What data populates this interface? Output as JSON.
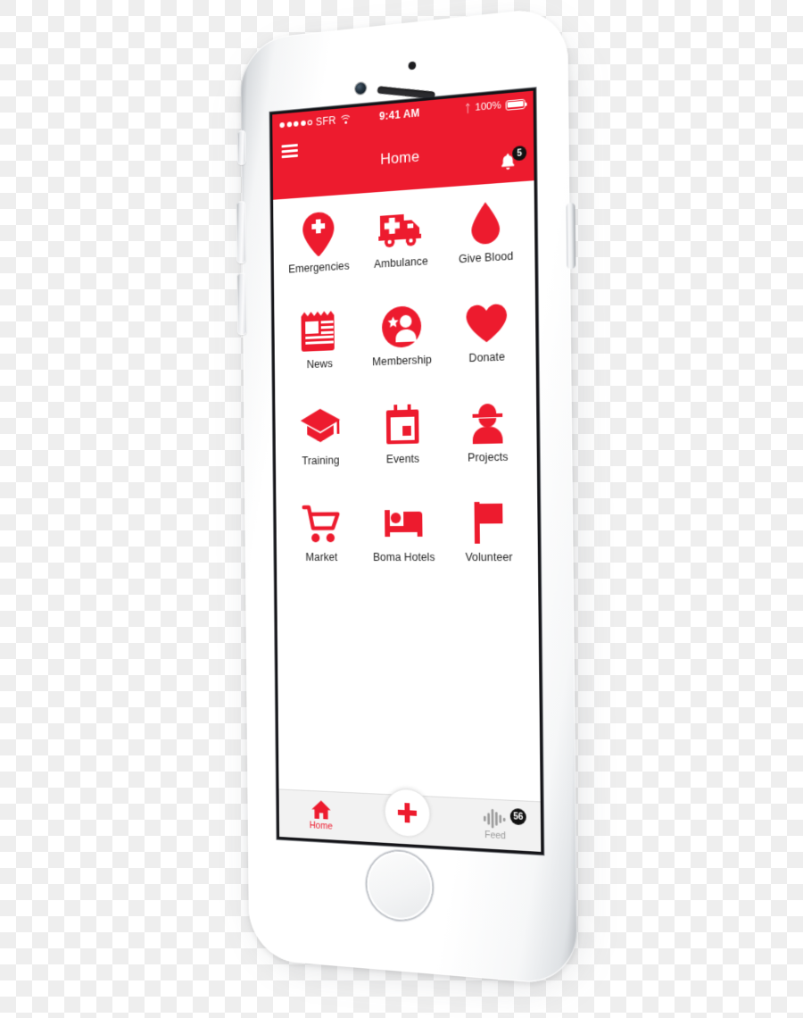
{
  "theme": {
    "brand_red": "#ED1B2E",
    "badge_black": "#111111",
    "tabbar_grey": "#F2F2F2",
    "inactive_grey": "#9A9A9A"
  },
  "device": {
    "name": "white-iphone-6",
    "hardware": {
      "mute_switch": "mute-switch",
      "volume_up": "volume-up-button",
      "volume_down": "volume-down-button",
      "power": "power-button",
      "home_button": "home-button",
      "front_camera": "front-camera",
      "earpiece": "earpiece-speaker",
      "proximity_sensor": "proximity-sensor"
    }
  },
  "status_bar": {
    "signal_dots_filled": 4,
    "signal_dots_total": 5,
    "carrier": "SFR",
    "wifi": "wifi-icon",
    "time": "9:41 AM",
    "bluetooth": "bluetooth-icon",
    "battery_percent": "100%",
    "battery_level": 100
  },
  "nav_bar": {
    "menu_icon": "hamburger-menu-icon",
    "title": "Home",
    "notifications": {
      "icon": "bell-icon",
      "badge_count": "5"
    }
  },
  "grid": {
    "tiles": [
      {
        "label": "Emergencies",
        "icon": "map-pin-cross-icon"
      },
      {
        "label": "Ambulance",
        "icon": "ambulance-icon"
      },
      {
        "label": "Give Blood",
        "icon": "blood-drop-icon"
      },
      {
        "label": "News",
        "icon": "newspaper-icon"
      },
      {
        "label": "Membership",
        "icon": "person-star-icon"
      },
      {
        "label": "Donate",
        "icon": "heart-icon"
      },
      {
        "label": "Training",
        "icon": "graduation-cap-icon"
      },
      {
        "label": "Events",
        "icon": "calendar-icon"
      },
      {
        "label": "Projects",
        "icon": "hard-hat-worker-icon"
      },
      {
        "label": "Market",
        "icon": "shopping-cart-icon"
      },
      {
        "label": "Boma Hotels",
        "icon": "bed-icon"
      },
      {
        "label": "Volunteer",
        "icon": "flag-icon"
      }
    ]
  },
  "tab_bar": {
    "home": {
      "label": "Home",
      "icon": "house-icon",
      "active": true
    },
    "fab": {
      "icon": "red-cross-plus-icon"
    },
    "feed": {
      "label": "Feed",
      "icon": "audio-waveform-icon",
      "badge_count": "56",
      "active": false
    }
  }
}
